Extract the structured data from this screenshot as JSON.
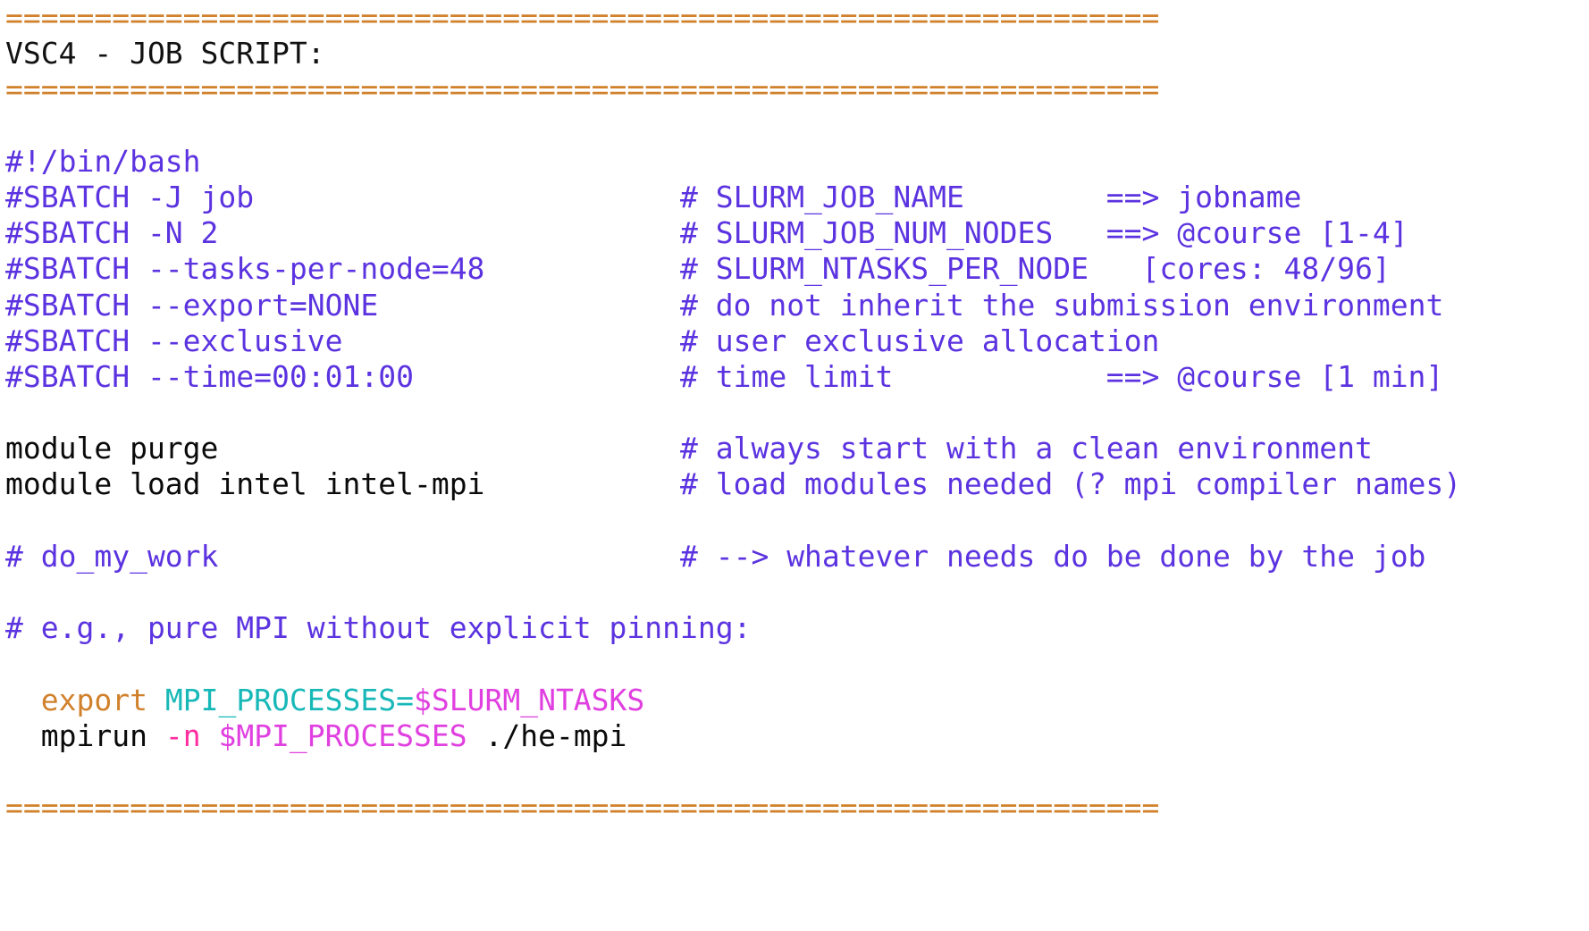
{
  "document": {
    "kind": "slide-code-listing",
    "title": "VSC4 - JOB SCRIPT:",
    "background": "#ffffff"
  },
  "palette": {
    "rule": "#D1812B",
    "title": "#111111",
    "comment": "#5B33E0",
    "plain": "#0A0A0A",
    "keyword": "#D1812B",
    "assigned_variable": "#18B8B8",
    "variable_substitution": "#E040E0",
    "flag": "#FF2D9E"
  },
  "rules": {
    "top": "=================================================================",
    "under_title": "=================================================================",
    "bottom": "================================================================="
  },
  "code": {
    "lines": [
      {
        "id": "rule-top",
        "kind": "rule",
        "text": "================================================================="
      },
      {
        "id": "title",
        "kind": "title",
        "text": "VSC4 - JOB SCRIPT:"
      },
      {
        "id": "rule-title",
        "kind": "rule",
        "text": "================================================================="
      },
      {
        "id": "blank-1",
        "kind": "blank",
        "text": ""
      },
      {
        "id": "shebang",
        "kind": "comment",
        "code": "#!/bin/bash",
        "comment": ""
      },
      {
        "id": "sbatch-J",
        "kind": "comment",
        "code": "#SBATCH -J job",
        "comment": "# SLURM_JOB_NAME        ==> jobname"
      },
      {
        "id": "sbatch-N",
        "kind": "comment",
        "code": "#SBATCH -N 2",
        "comment": "# SLURM_JOB_NUM_NODES   ==> @course [1-4]"
      },
      {
        "id": "sbatch-tasks",
        "kind": "comment",
        "code": "#SBATCH --tasks-per-node=48",
        "comment": "# SLURM_NTASKS_PER_NODE   [cores: 48/96]"
      },
      {
        "id": "sbatch-export",
        "kind": "comment",
        "code": "#SBATCH --export=NONE",
        "comment": "# do not inherit the submission environment"
      },
      {
        "id": "sbatch-excl",
        "kind": "comment",
        "code": "#SBATCH --exclusive",
        "comment": "# user exclusive allocation"
      },
      {
        "id": "sbatch-time",
        "kind": "comment",
        "code": "#SBATCH --time=00:01:00",
        "comment": "# time limit            ==> @course [1 min]"
      },
      {
        "id": "blank-2",
        "kind": "blank",
        "text": ""
      },
      {
        "id": "module-purge",
        "kind": "mixed",
        "code": "module purge",
        "comment": "# always start with a clean environment"
      },
      {
        "id": "module-load",
        "kind": "mixed",
        "code": "module load intel intel-mpi",
        "comment": "# load modules needed (? mpi compiler names)"
      },
      {
        "id": "blank-3",
        "kind": "blank",
        "text": ""
      },
      {
        "id": "do-my-work",
        "kind": "comment",
        "code": "# do_my_work",
        "comment": "# --> whatever needs do be done by the job"
      },
      {
        "id": "blank-4",
        "kind": "blank",
        "text": ""
      },
      {
        "id": "eg-comment",
        "kind": "comment",
        "code": "# e.g., pure MPI without explicit pinning:",
        "comment": ""
      },
      {
        "id": "blank-5",
        "kind": "blank",
        "text": ""
      },
      {
        "id": "export-line",
        "kind": "shell",
        "tokens": [
          {
            "t": "  ",
            "c": "plain"
          },
          {
            "t": "export",
            "c": "keyword"
          },
          {
            "t": " ",
            "c": "plain"
          },
          {
            "t": "MPI_PROCESSES=",
            "c": "assigned_variable"
          },
          {
            "t": "$SLURM_NTASKS",
            "c": "variable_substitution"
          }
        ]
      },
      {
        "id": "mpirun-line",
        "kind": "shell",
        "tokens": [
          {
            "t": "  ",
            "c": "plain"
          },
          {
            "t": "mpirun ",
            "c": "plain"
          },
          {
            "t": "-n",
            "c": "flag"
          },
          {
            "t": " ",
            "c": "plain"
          },
          {
            "t": "$MPI_PROCESSES",
            "c": "variable_substitution"
          },
          {
            "t": " ./he-mpi",
            "c": "plain"
          }
        ]
      },
      {
        "id": "blank-6",
        "kind": "blank",
        "text": ""
      },
      {
        "id": "rule-bottom",
        "kind": "rule",
        "text": "================================================================="
      }
    ]
  },
  "columns": {
    "code_column_chars": 0,
    "comment_column_chars": 38
  }
}
